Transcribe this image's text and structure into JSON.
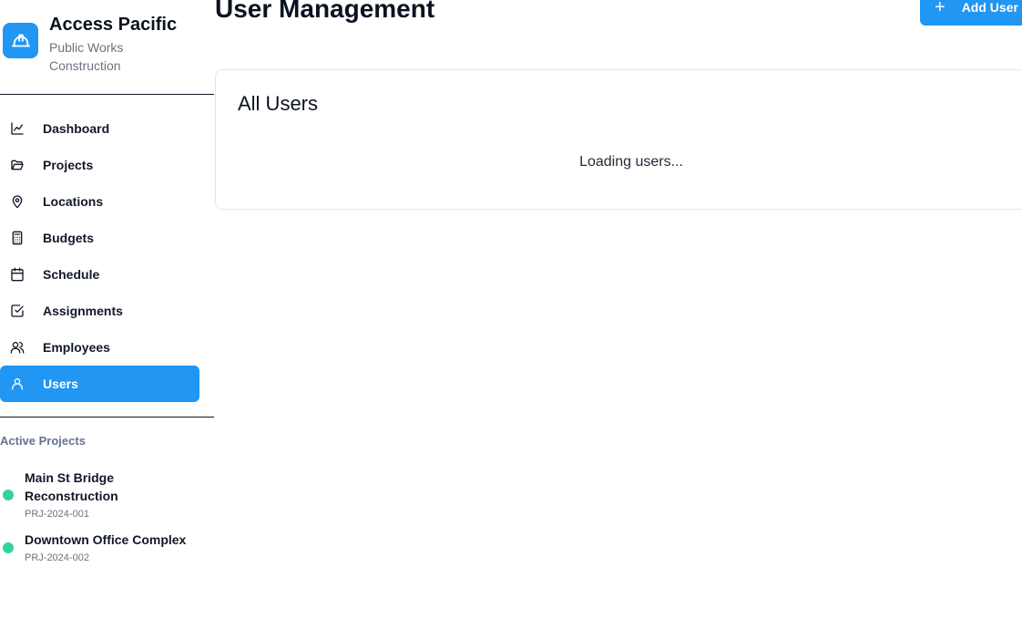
{
  "brand": {
    "title": "Access Pacific",
    "subtitle_line1": "Public Works",
    "subtitle_line2": "Construction",
    "logo_icon": "hard-hat-icon",
    "accent_color": "#2196f3"
  },
  "nav": {
    "items": [
      {
        "label": "Dashboard",
        "icon": "chart-line-icon"
      },
      {
        "label": "Projects",
        "icon": "folder-open-icon"
      },
      {
        "label": "Locations",
        "icon": "map-pin-icon"
      },
      {
        "label": "Budgets",
        "icon": "calculator-icon"
      },
      {
        "label": "Schedule",
        "icon": "calendar-icon"
      },
      {
        "label": "Assignments",
        "icon": "check-square-icon"
      },
      {
        "label": "Employees",
        "icon": "users-icon"
      },
      {
        "label": "Users",
        "icon": "user-icon",
        "active": true
      }
    ]
  },
  "active_projects": {
    "title": "Active Projects",
    "status_color": "#34d399",
    "items": [
      {
        "name_line1": "Main St Bridge",
        "name_line2": "Reconstruction",
        "code": "PRJ-2024-001"
      },
      {
        "name_line1": "Downtown Office Complex",
        "name_line2": "",
        "code": "PRJ-2024-002"
      }
    ]
  },
  "header": {
    "title": "User Management",
    "add_button_label": "Add User"
  },
  "users_card": {
    "title": "All Users",
    "loading_text": "Loading users..."
  }
}
